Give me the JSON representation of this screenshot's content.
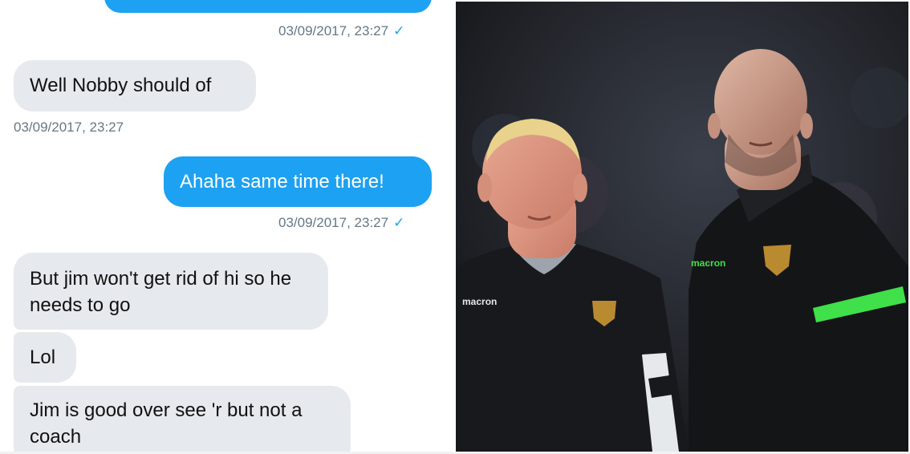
{
  "messages": {
    "m1": {
      "text": "Well Nobby should of",
      "time": "03/09/2017, 23:27"
    },
    "m2": {
      "text": "Ahaha same time there!",
      "time": "03/09/2017, 23:27"
    },
    "m3": {
      "text": "But jim won't get rid of hi so he needs to go"
    },
    "m4": {
      "text": "Lol"
    },
    "m5": {
      "text": "Jim is good over see 'r but not a coach"
    }
  },
  "top_time": "03/09/2017, 23:27",
  "read_check": "✓",
  "photo": {
    "left_logo": "macron",
    "right_logo": "macron"
  },
  "colors": {
    "sent_bubble": "#1da1f2",
    "received_bubble": "#e6e9ed",
    "timestamp": "#657786",
    "accent_stripe": "#3fe04a"
  }
}
